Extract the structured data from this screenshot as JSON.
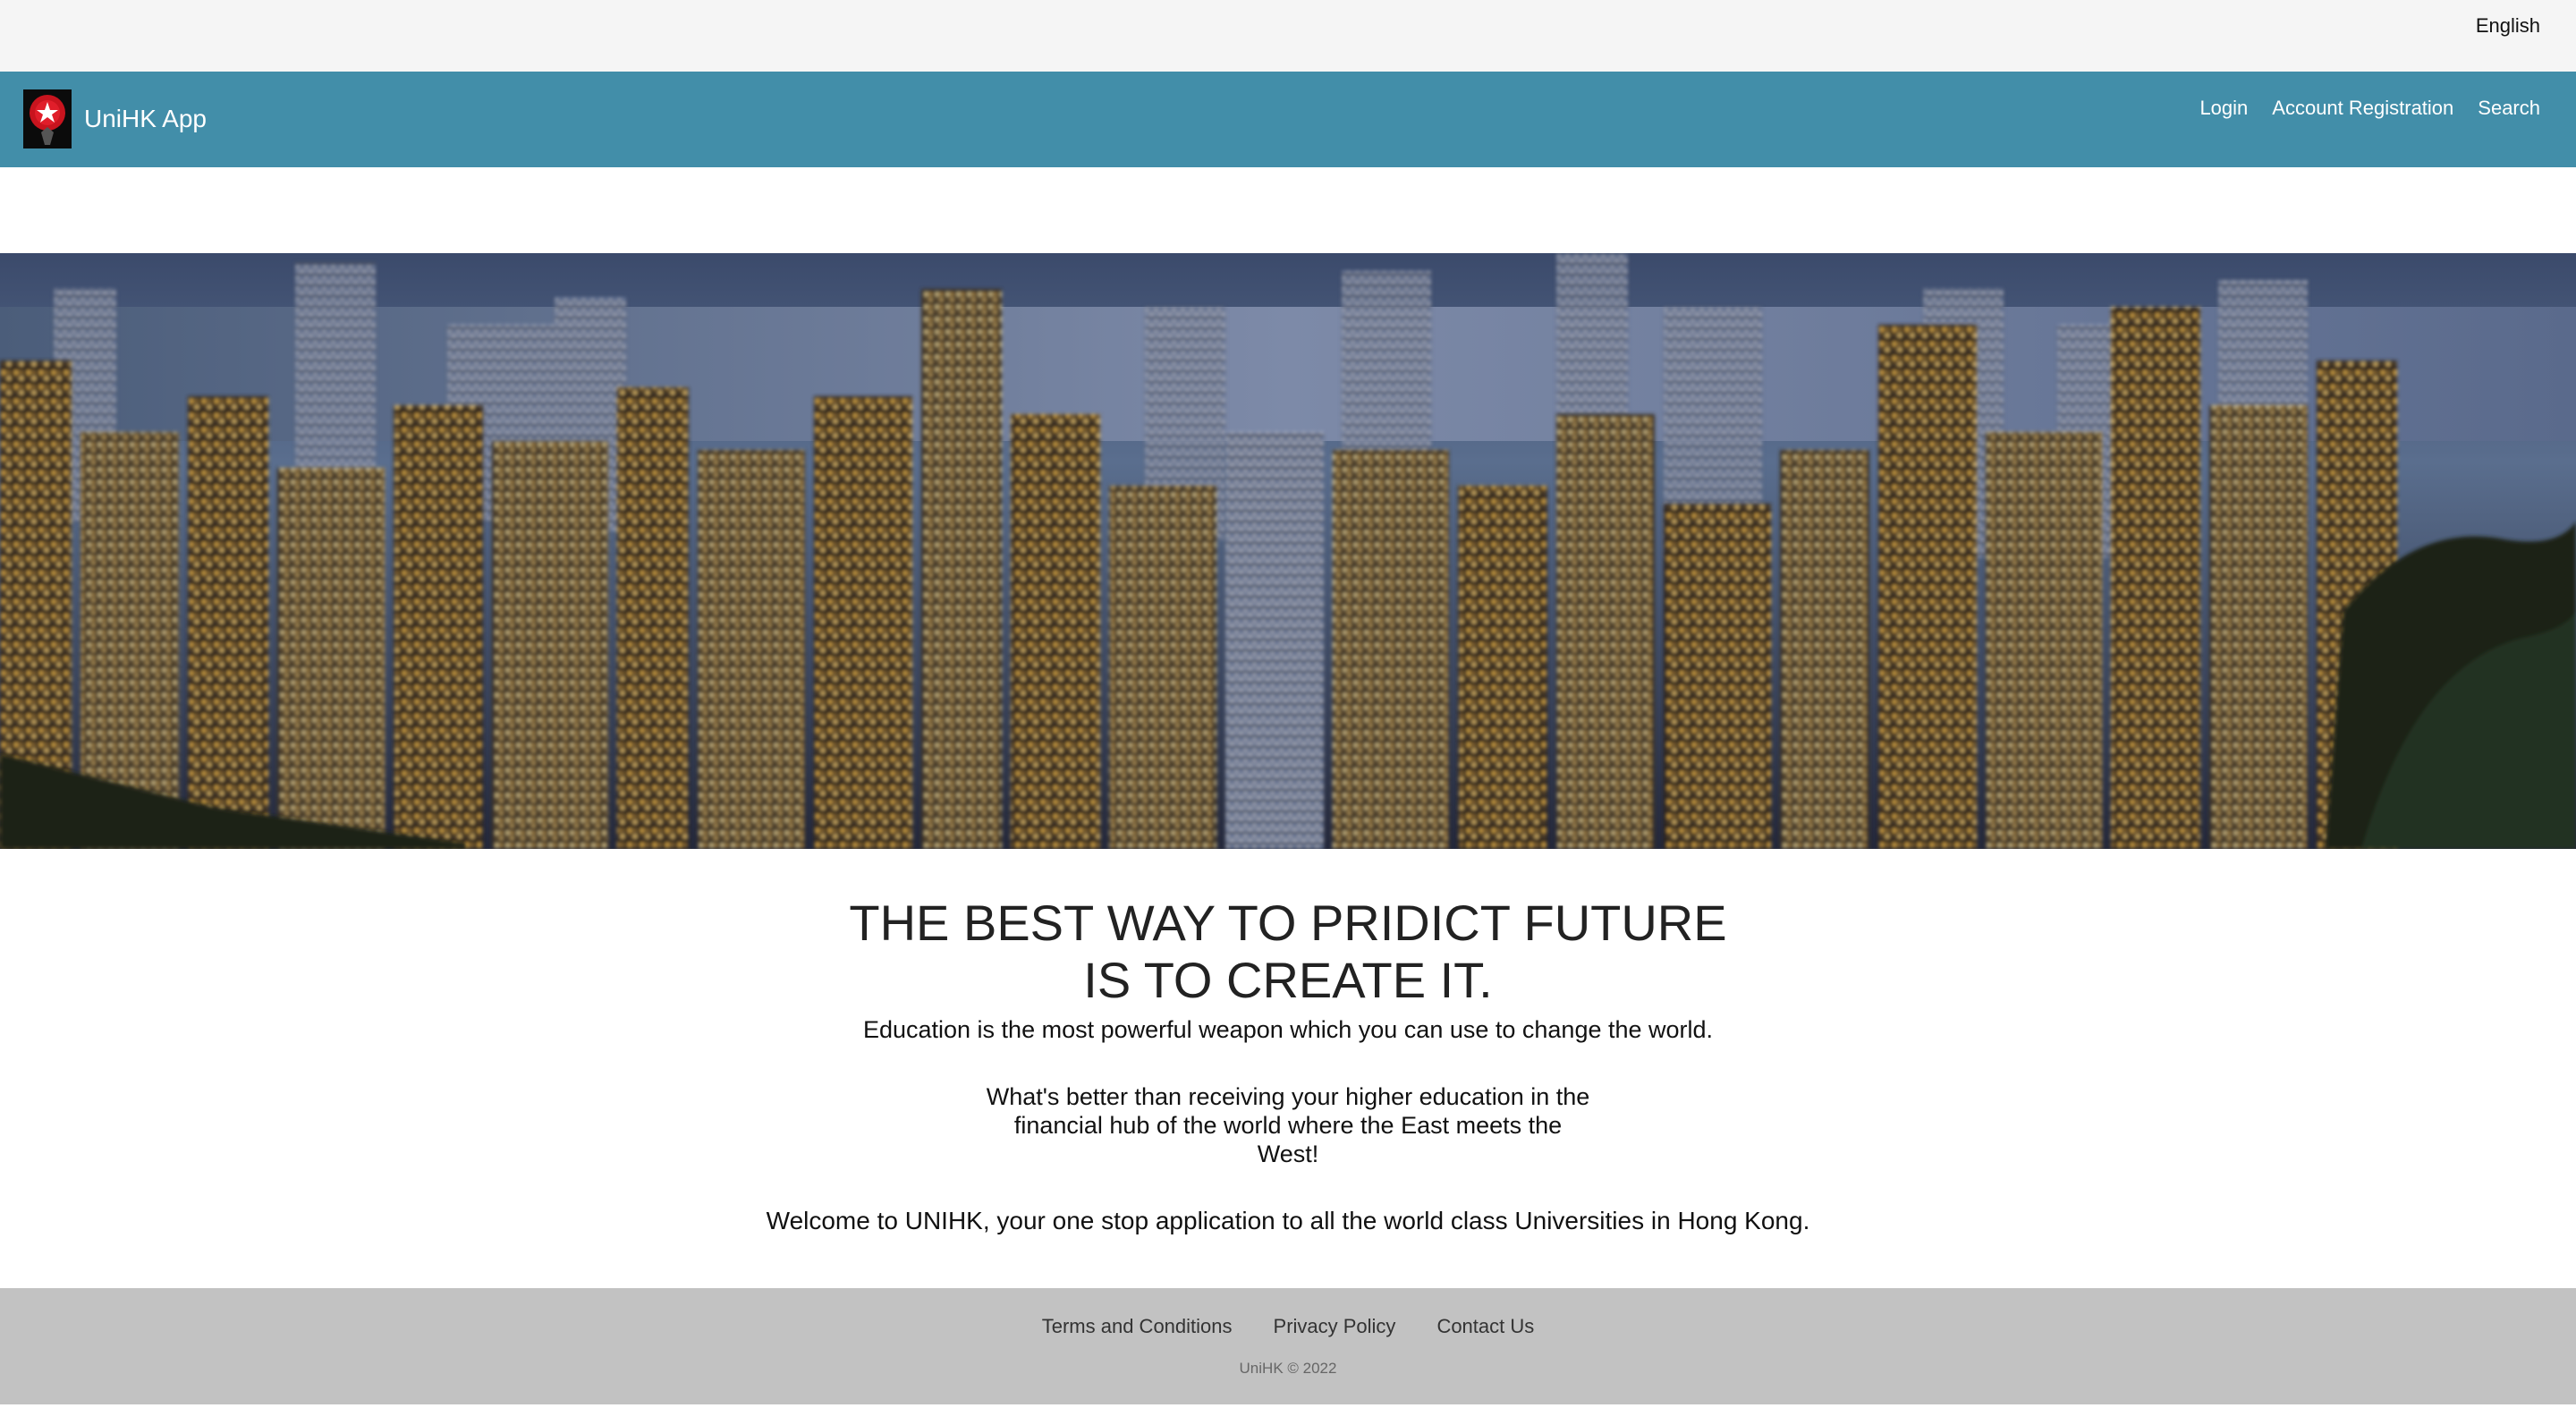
{
  "top_bar": {
    "language_label": "English"
  },
  "navbar": {
    "brand_name": "UniHK App",
    "links": [
      {
        "label": "Login"
      },
      {
        "label": "Account Registration"
      },
      {
        "label": "Search"
      }
    ],
    "background_color": "#428ea9"
  },
  "hero": {
    "icon": "city-skyline-image"
  },
  "main": {
    "headline": "THE BEST WAY TO PRIDICT FUTURE IS TO CREATE IT.",
    "tagline": "Education is the most powerful weapon which you can use to change the world.",
    "paragraph_2": "What's better than receiving your higher education in the financial hub of the world where the East meets the West!",
    "paragraph_3": "Welcome to UNIHK, your one stop application to all the world class Universities in Hong Kong."
  },
  "footer": {
    "links": [
      {
        "label": "Terms and Conditions"
      },
      {
        "label": "Privacy Policy"
      },
      {
        "label": "Contact Us"
      }
    ],
    "copyright": "UniHK © 2022",
    "background_color": "#c2c2c2"
  }
}
